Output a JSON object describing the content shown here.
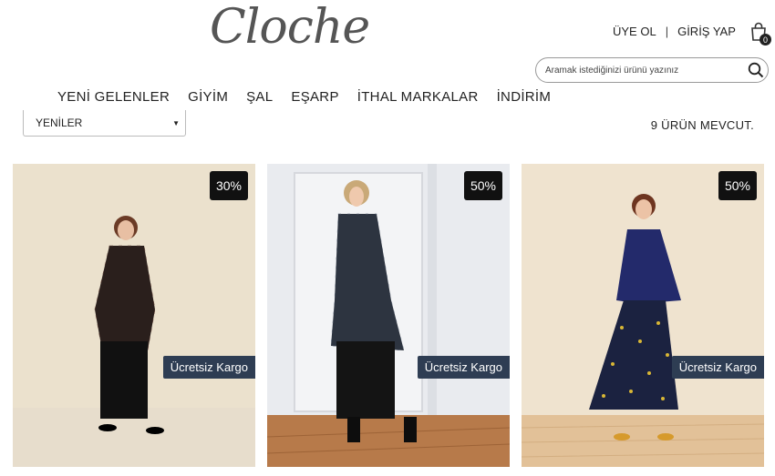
{
  "brand": {
    "logo": "Cloche"
  },
  "account": {
    "register": "ÜYE OL",
    "separator": "|",
    "login": "GİRİŞ YAP"
  },
  "cart": {
    "count": "0",
    "icon": "shopping-bag-icon"
  },
  "search": {
    "placeholder": "Aramak istediğinizi ürünü yazınız",
    "value": "",
    "icon": "search-icon"
  },
  "nav": {
    "items": [
      {
        "label": "YENİ GELENLER"
      },
      {
        "label": "GİYİM"
      },
      {
        "label": "ŞAL"
      },
      {
        "label": "EŞARP"
      },
      {
        "label": "İTHAL MARKALAR"
      },
      {
        "label": "İNDİRİM"
      }
    ]
  },
  "sort": {
    "selected": "YENİLER"
  },
  "listing": {
    "count_text": "9 ÜRÜN MEVCUT."
  },
  "products": [
    {
      "discount": "30%",
      "badge": "Ücretsiz Kargo"
    },
    {
      "discount": "50%",
      "badge": "Ücretsiz Kargo"
    },
    {
      "discount": "50%",
      "badge": "Ücretsiz Kargo"
    }
  ],
  "colors": {
    "cargo_badge": "#2e3d53",
    "discount_badge": "#111111"
  }
}
